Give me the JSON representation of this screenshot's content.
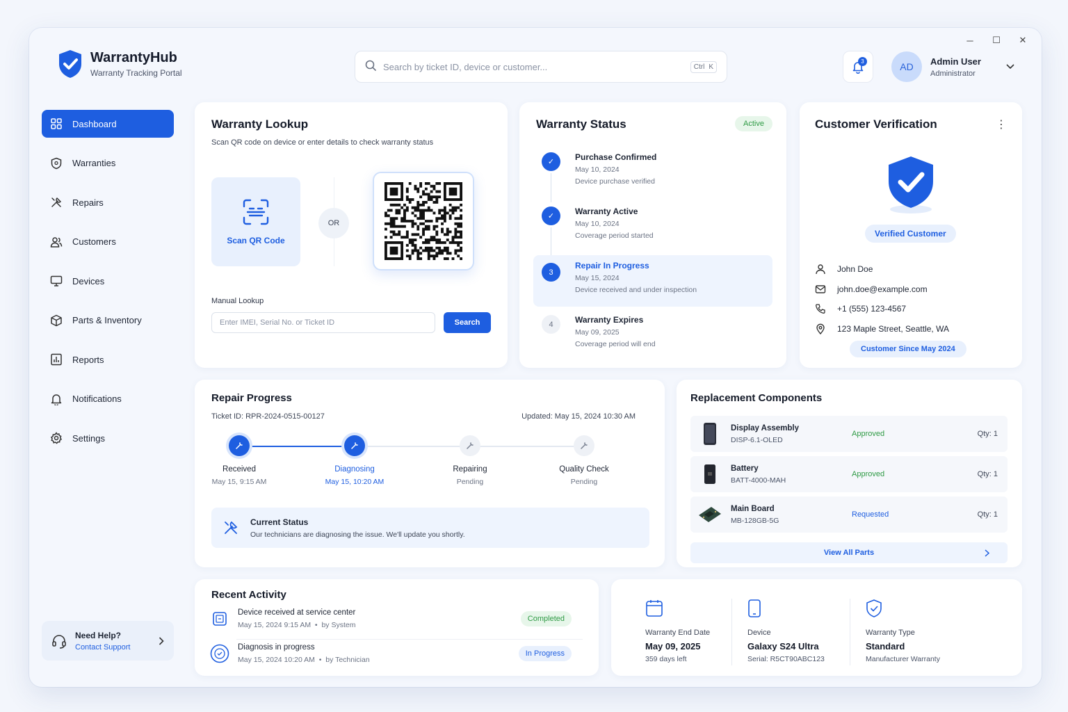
{
  "window_controls": {
    "minimize": "─",
    "maximize": "☐",
    "close": "✕"
  },
  "app": {
    "name": "WarrantyHub",
    "subtitle": "Warranty Tracking Portal"
  },
  "search": {
    "placeholder": "Search by ticket ID, device or customer...",
    "shortcut_ctrl": "Ctrl",
    "shortcut_key": "K"
  },
  "notifications": {
    "count": "3"
  },
  "user": {
    "initials": "AD",
    "name": "Admin User",
    "role": "Administrator"
  },
  "sidebar": {
    "items": [
      {
        "label": "Dashboard",
        "icon": "grid-icon",
        "active": true
      },
      {
        "label": "Warranties",
        "icon": "shield-icon"
      },
      {
        "label": "Repairs",
        "icon": "tools-icon"
      },
      {
        "label": "Customers",
        "icon": "users-icon"
      },
      {
        "label": "Devices",
        "icon": "monitor-icon"
      },
      {
        "label": "Parts & Inventory",
        "icon": "box-icon"
      },
      {
        "label": "Reports",
        "icon": "report-icon"
      },
      {
        "label": "Notifications",
        "icon": "bell-icon"
      },
      {
        "label": "Settings",
        "icon": "gear-icon"
      }
    ],
    "help": {
      "title": "Need Help?",
      "link": "Contact Support"
    }
  },
  "lookup": {
    "title": "Warranty Lookup",
    "subtitle": "Scan QR code on device or enter details to check warranty status",
    "scan_label": "Scan QR Code",
    "or": "OR",
    "manual_label": "Manual Lookup",
    "input_placeholder": "Enter IMEI, Serial No. or Ticket ID",
    "search_button": "Search"
  },
  "status": {
    "title": "Warranty Status",
    "badge": "Active",
    "steps": [
      {
        "num": "✓",
        "title": "Purchase Confirmed",
        "date": "May 10, 2024",
        "desc": "Device purchase verified",
        "state": "done"
      },
      {
        "num": "✓",
        "title": "Warranty Active",
        "date": "May 10, 2024",
        "desc": "Coverage period started",
        "state": "done"
      },
      {
        "num": "3",
        "title": "Repair In Progress",
        "date": "May 15, 2024",
        "desc": "Device received and under inspection",
        "state": "current"
      },
      {
        "num": "4",
        "title": "Warranty Expires",
        "date": "May 09, 2025",
        "desc": "Coverage period will end",
        "state": "pending"
      }
    ]
  },
  "customer": {
    "title": "Customer Verification",
    "verified": "Verified Customer",
    "name": "John Doe",
    "email": "john.doe@example.com",
    "phone": "+1 (555) 123-4567",
    "address": "123 Maple Street, Seattle, WA",
    "since": "Customer Since May 2024"
  },
  "repair": {
    "title": "Repair Progress",
    "ticket": "Ticket ID: RPR-2024-0515-00127",
    "updated": "Updated: May 15, 2024 10:30 AM",
    "steps": [
      {
        "label": "Received",
        "time": "May 15, 9:15 AM",
        "state": "done"
      },
      {
        "label": "Diagnosing",
        "time": "May 15, 10:20 AM",
        "state": "current"
      },
      {
        "label": "Repairing",
        "time": "Pending",
        "state": "pending"
      },
      {
        "label": "Quality Check",
        "time": "Pending",
        "state": "pending"
      }
    ],
    "current_status_title": "Current Status",
    "current_status_text": "Our technicians are diagnosing the issue. We'll update you shortly."
  },
  "components": {
    "title": "Replacement Components",
    "items": [
      {
        "name": "Display Assembly",
        "sku": "DISP-6.1-OLED",
        "status": "Approved",
        "qty": "Qty: 1",
        "icon": "phone-display-icon"
      },
      {
        "name": "Battery",
        "sku": "BATT-4000-MAH",
        "status": "Approved",
        "qty": "Qty: 1",
        "icon": "battery-icon"
      },
      {
        "name": "Main Board",
        "sku": "MB-128GB-5G",
        "status": "Requested",
        "qty": "Qty: 1",
        "icon": "circuit-board-icon"
      }
    ],
    "view_all": "View All Parts"
  },
  "activity": {
    "title": "Recent Activity",
    "items": [
      {
        "title": "Device received at service center",
        "time": "May 15, 2024 9:15 AM",
        "by": "by System",
        "badge": "Completed",
        "icon": "inbox-icon"
      },
      {
        "title": "Diagnosis in progress",
        "time": "May 15, 2024 10:20 AM",
        "by": "by Technician",
        "badge": "In Progress",
        "icon": "diagnosis-icon"
      }
    ]
  },
  "summary": {
    "end_date": {
      "label": "Warranty End Date",
      "value": "May 09, 2025",
      "sub": "359 days left"
    },
    "device": {
      "label": "Device",
      "value": "Galaxy S24 Ultra",
      "sub": "Serial: R5CT90ABC123"
    },
    "type": {
      "label": "Warranty Type",
      "value": "Standard",
      "sub": "Manufacturer Warranty"
    }
  },
  "colors": {
    "primary": "#1e5ee0",
    "success": "#2e9a44",
    "success_bg": "#e7f6ea",
    "info_bg": "#e8f0fd",
    "window_bg": "#f4f7fd"
  }
}
